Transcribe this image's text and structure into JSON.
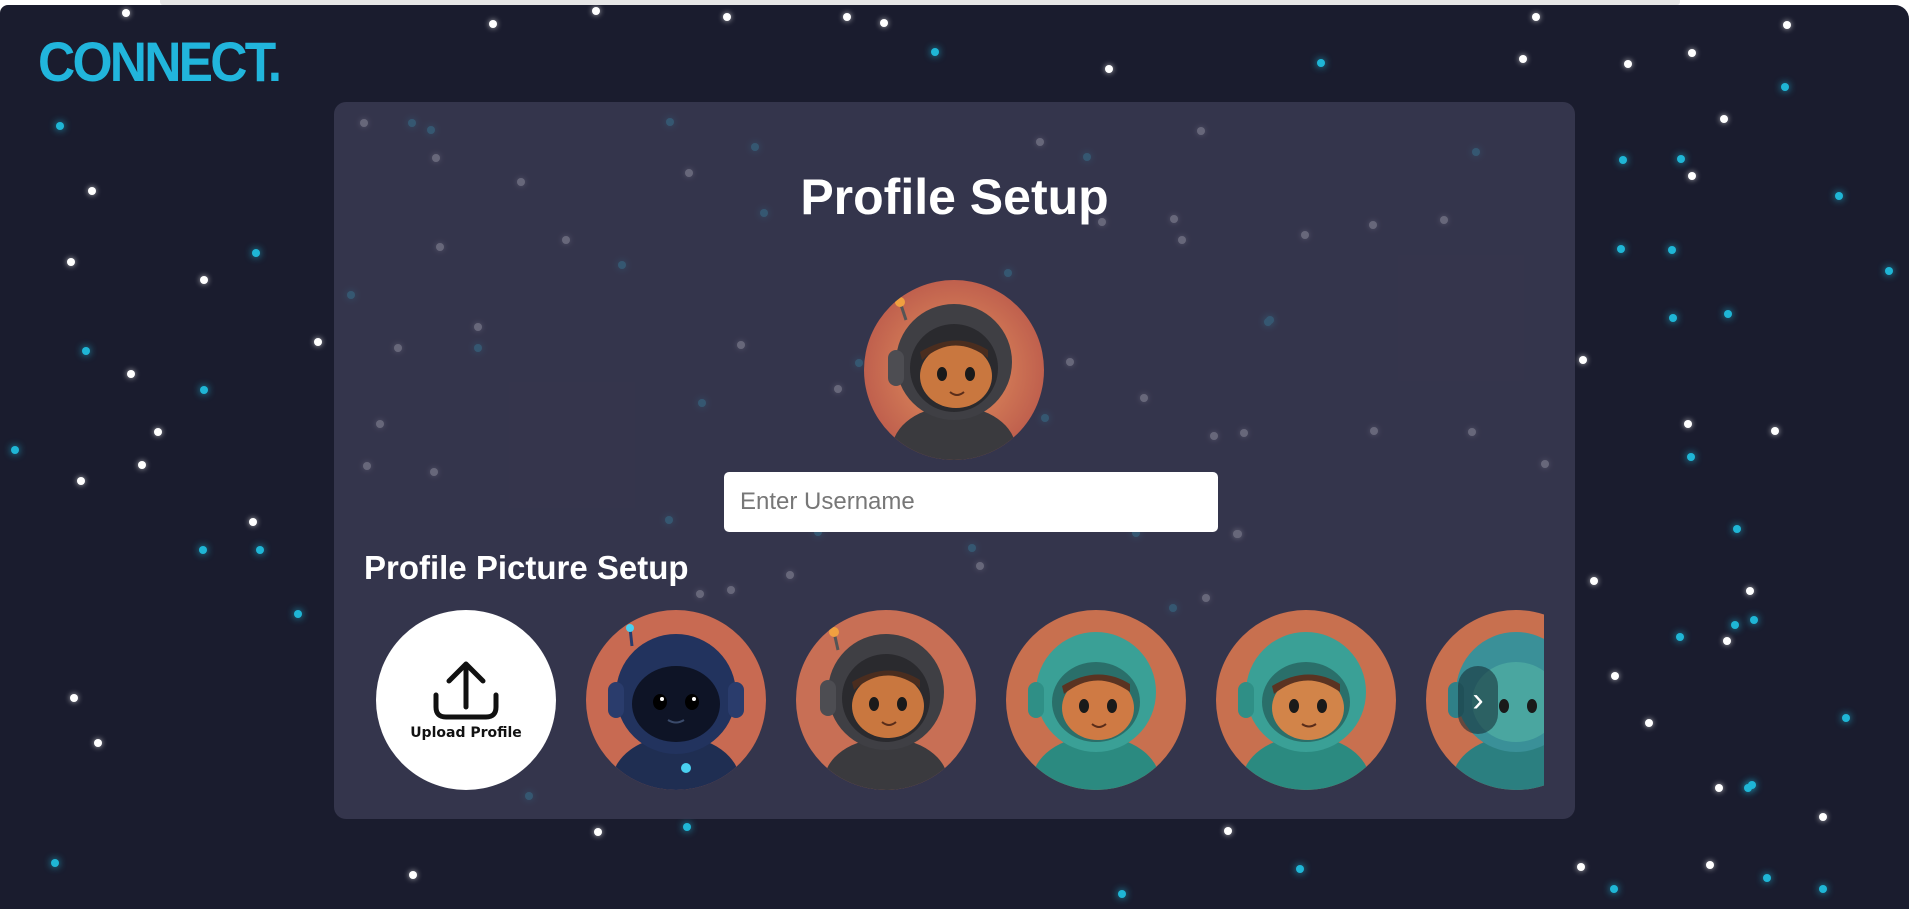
{
  "app": {
    "logo_text": "CONNECT."
  },
  "page": {
    "title": "Profile Setup"
  },
  "username": {
    "placeholder": "Enter Username",
    "value": ""
  },
  "picture_section": {
    "heading": "Profile Picture Setup",
    "upload_label": "Upload Profile",
    "next_label": "›",
    "avatars": [
      {
        "name": "astronaut-dark-blue"
      },
      {
        "name": "astronaut-black-antenna"
      },
      {
        "name": "astronaut-teal"
      },
      {
        "name": "astronaut-teal-2"
      },
      {
        "name": "astronaut-teal-3"
      }
    ]
  },
  "colors": {
    "background": "#1a1c2e",
    "card": "#3c3c54",
    "brand": "#21b5dc",
    "star_white": "#ffffff",
    "star_cyan": "#1fb6d6"
  }
}
